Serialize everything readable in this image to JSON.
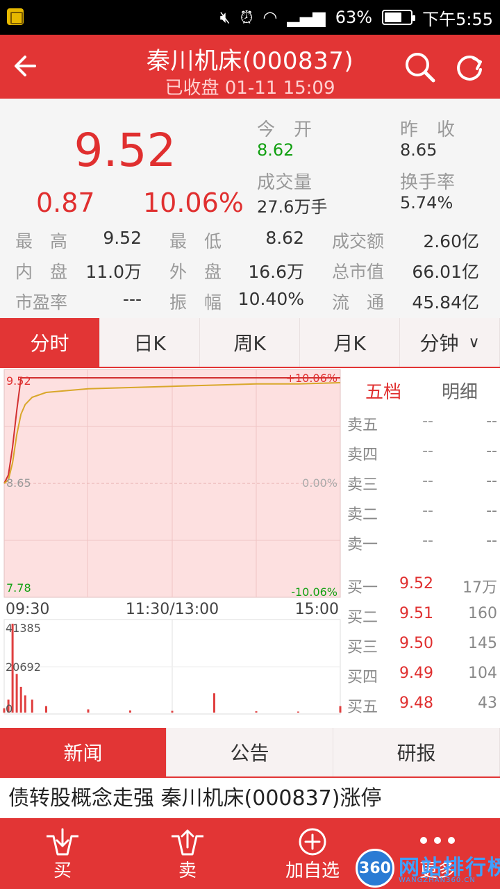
{
  "status_bar": {
    "battery": "63%",
    "time": "下午5:55"
  },
  "header": {
    "title": "秦川机床(000837)",
    "subtitle": "已收盘 01-11 15:09"
  },
  "quote": {
    "price": "9.52",
    "change": "0.87",
    "change_pct": "10.06%",
    "open_label": "今　开",
    "open": "8.62",
    "prev_close_label": "昨　收",
    "prev_close": "8.65",
    "volume_label": "成交量",
    "volume": "27.6万手",
    "turnover_rate_label": "换手率",
    "turnover_rate": "5.74%",
    "grid": [
      [
        {
          "label": "最　高",
          "value": "9.52",
          "color": "red"
        },
        {
          "label": "最　低",
          "value": "8.62",
          "color": "green"
        },
        {
          "label": "成交额",
          "value": "2.60亿",
          "color": "normal"
        }
      ],
      [
        {
          "label": "内　盘",
          "value": "11.0万",
          "color": "normal"
        },
        {
          "label": "外　盘",
          "value": "16.6万",
          "color": "normal"
        },
        {
          "label": "总市值",
          "value": "66.01亿",
          "color": "normal"
        }
      ],
      [
        {
          "label": "市盈率",
          "value": "---",
          "color": "normal"
        },
        {
          "label": "振　幅",
          "value": "10.40%",
          "color": "normal"
        },
        {
          "label": "流　通",
          "value": "45.84亿",
          "color": "normal"
        }
      ]
    ]
  },
  "tabs": [
    "分时",
    "日K",
    "周K",
    "月K",
    "分钟"
  ],
  "chart": {
    "price_high": "9.52",
    "price_mid": "8.65",
    "price_low": "7.78",
    "pct_high": "+10.06%",
    "pct_mid": "0.00%",
    "pct_low": "-10.06%",
    "time_start": "09:30",
    "time_mid": "11:30/13:00",
    "time_end": "15:00",
    "vol_high": "41385",
    "vol_mid": "20692",
    "vol_zero": "0"
  },
  "chart_data": {
    "type": "line",
    "x": [
      "09:30",
      "09:33",
      "09:36",
      "09:39",
      "09:42",
      "09:45",
      "09:50",
      "10:00",
      "10:30",
      "11:00",
      "11:30",
      "13:30",
      "14:00",
      "14:30",
      "15:00"
    ],
    "series": [
      {
        "values": [
          8.65,
          8.72,
          8.95,
          9.25,
          9.52,
          9.52,
          9.52,
          9.52,
          9.52,
          9.52,
          9.52,
          9.52,
          9.52,
          9.52,
          9.52
        ]
      },
      {
        "values": [
          8.65,
          8.68,
          8.82,
          9.05,
          9.22,
          9.3,
          9.36,
          9.4,
          9.43,
          9.44,
          9.45,
          9.46,
          9.47,
          9.47,
          9.48
        ]
      }
    ],
    "ylim": [
      7.78,
      9.52
    ],
    "volume": [
      2000,
      6000,
      41385,
      18000,
      12000,
      8000,
      6000,
      3000,
      1500,
      1000,
      800,
      9000,
      600,
      500,
      3000
    ]
  },
  "orderbook": {
    "tab_active": "五档",
    "tab_inactive": "明细",
    "asks": [
      {
        "label": "卖五",
        "price": "--",
        "vol": "--"
      },
      {
        "label": "卖四",
        "price": "--",
        "vol": "--"
      },
      {
        "label": "卖三",
        "price": "--",
        "vol": "--"
      },
      {
        "label": "卖二",
        "price": "--",
        "vol": "--"
      },
      {
        "label": "卖一",
        "price": "--",
        "vol": "--"
      }
    ],
    "bids": [
      {
        "label": "买一",
        "price": "9.52",
        "vol": "17万"
      },
      {
        "label": "买二",
        "price": "9.51",
        "vol": "160"
      },
      {
        "label": "买三",
        "price": "9.50",
        "vol": "145"
      },
      {
        "label": "买四",
        "price": "9.49",
        "vol": "104"
      },
      {
        "label": "买五",
        "price": "9.48",
        "vol": "43"
      }
    ]
  },
  "news_tabs": [
    "新闻",
    "公告",
    "研报"
  ],
  "headline": "债转股概念走强 秦川机床(000837)涨停",
  "bottom": {
    "buy": "买",
    "sell": "卖",
    "watch": "加自选",
    "more": "更多"
  },
  "watermark": {
    "badge": "360",
    "text": "网站排行榜",
    "sub": "WANGZHAN360.CN"
  }
}
